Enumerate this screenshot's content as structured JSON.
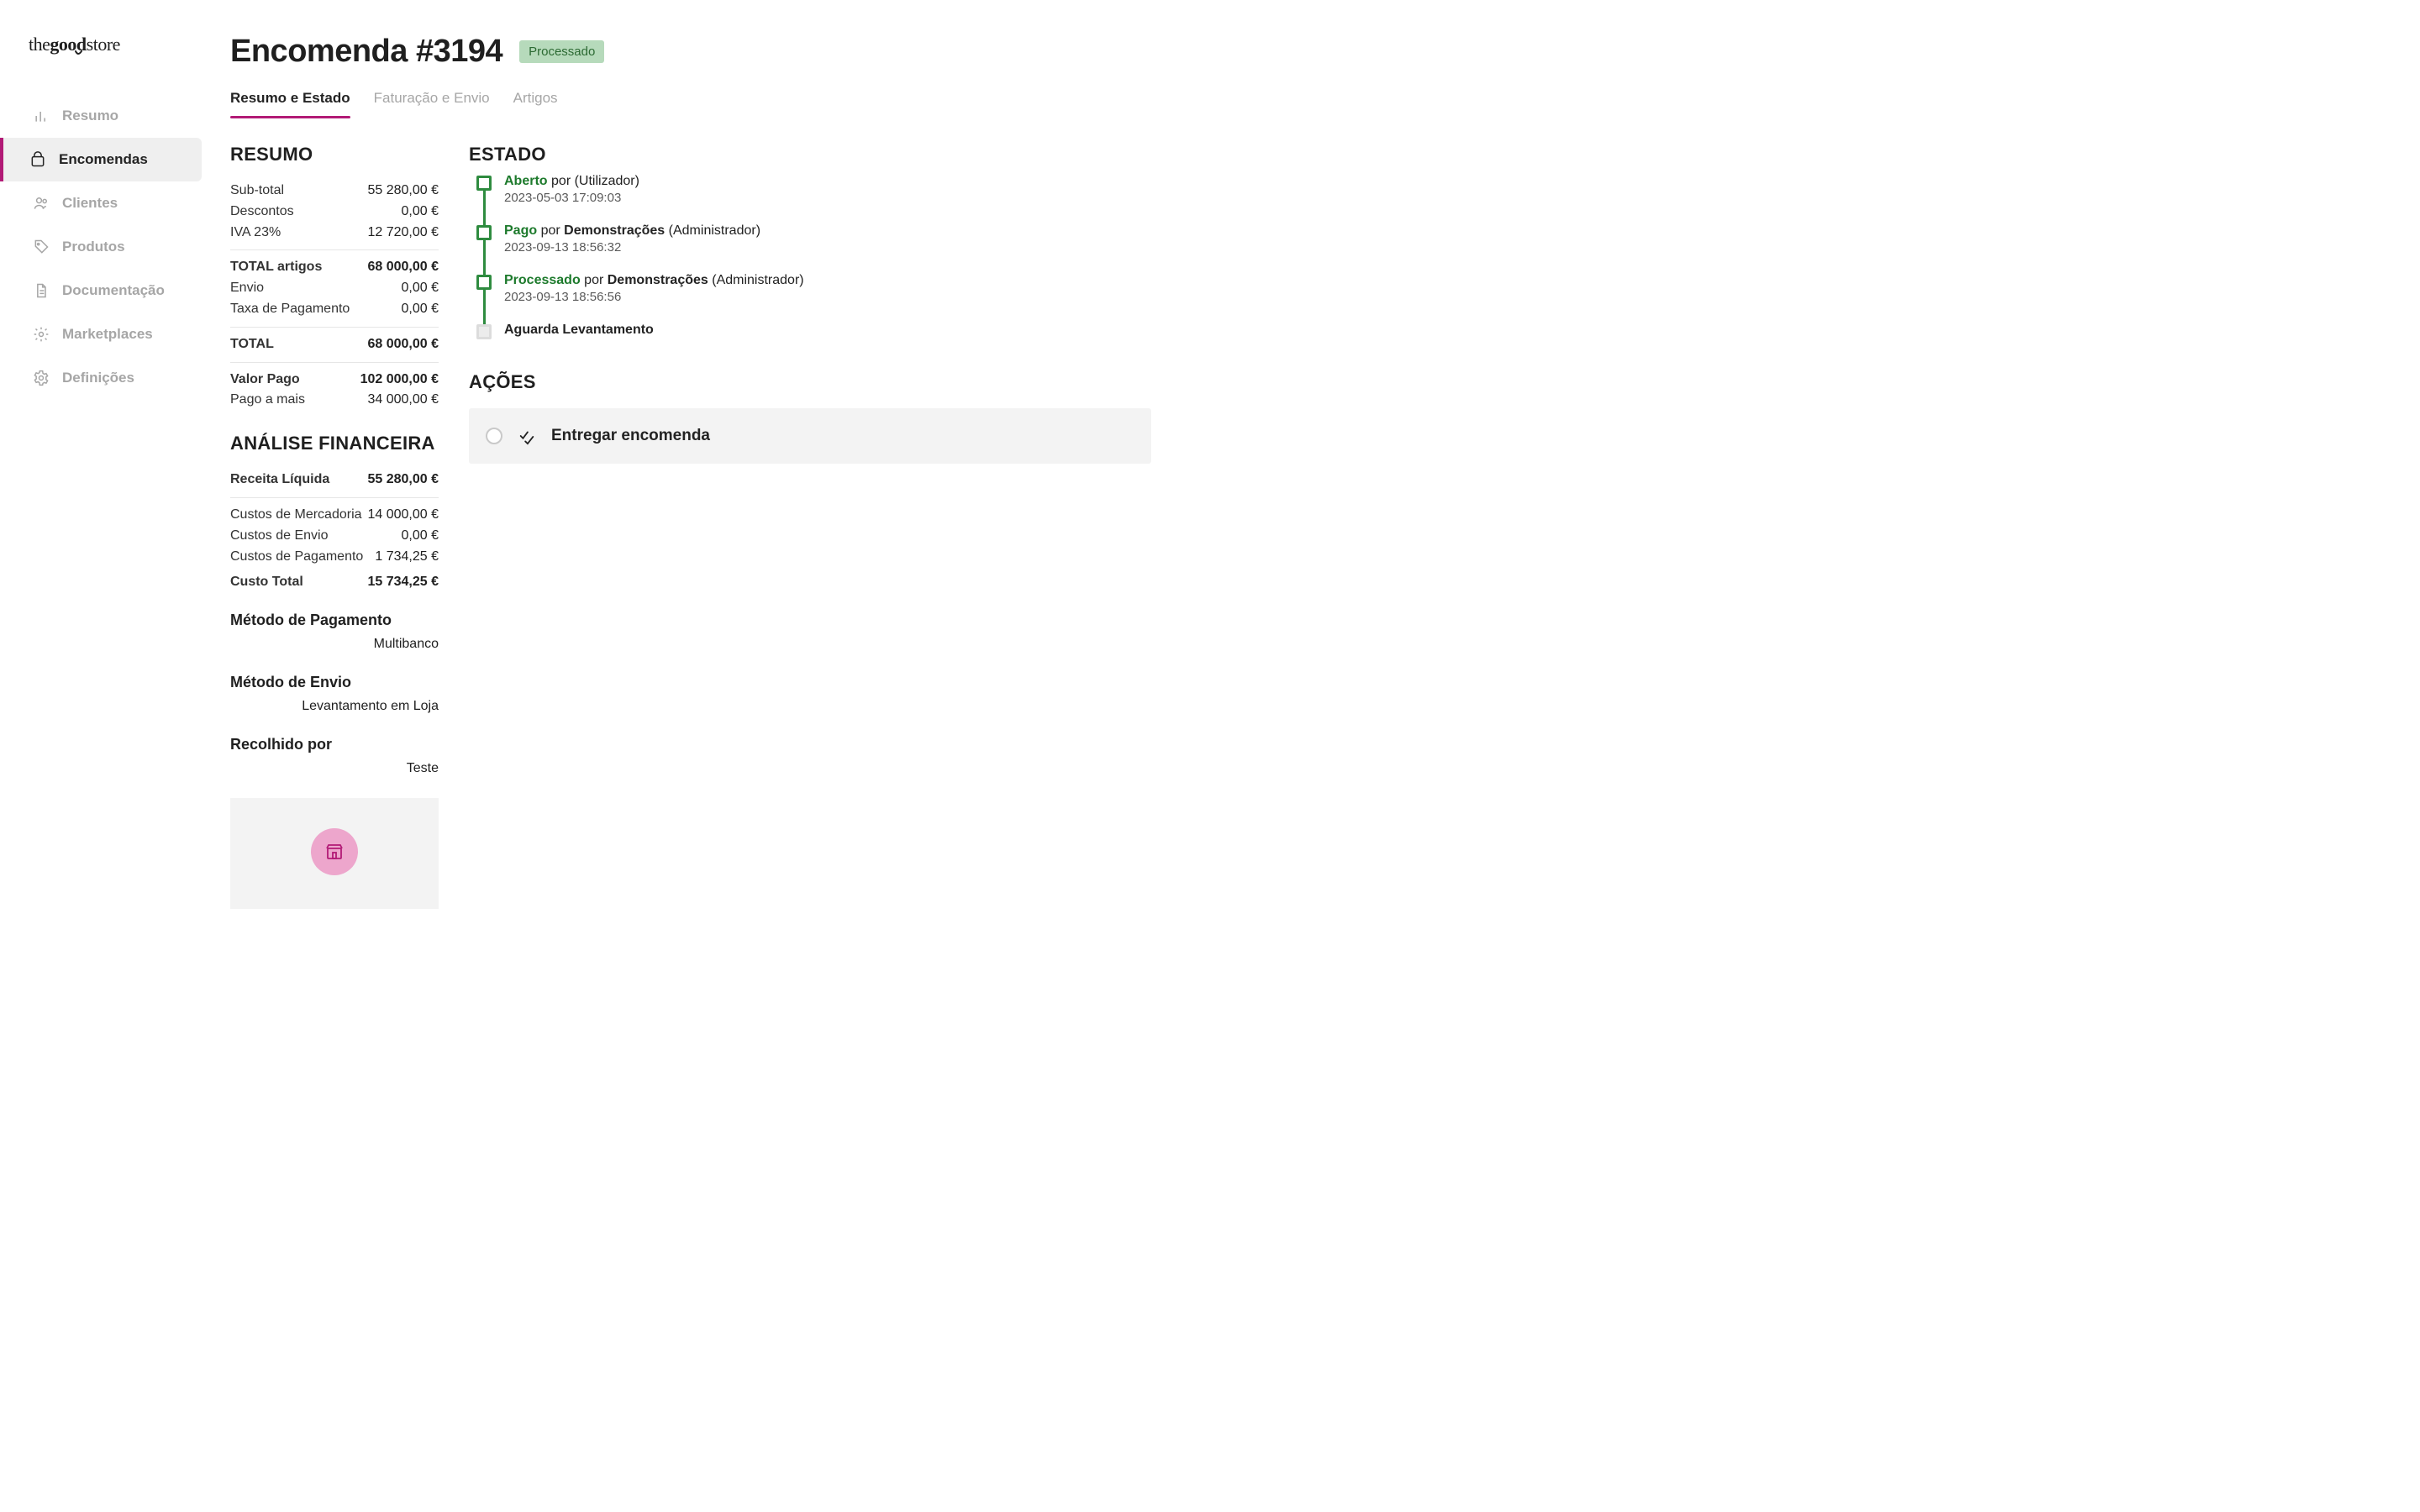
{
  "brand": {
    "name": "thegoodstore"
  },
  "sidebar": {
    "items": [
      {
        "label": "Resumo",
        "name": "sidebar-item-resumo",
        "icon": "bar-chart-icon",
        "active": false
      },
      {
        "label": "Encomendas",
        "name": "sidebar-item-encomendas",
        "icon": "package-icon",
        "active": true
      },
      {
        "label": "Clientes",
        "name": "sidebar-item-clientes",
        "icon": "users-icon",
        "active": false
      },
      {
        "label": "Produtos",
        "name": "sidebar-item-produtos",
        "icon": "tag-icon",
        "active": false
      },
      {
        "label": "Documentação",
        "name": "sidebar-item-documentacao",
        "icon": "file-icon",
        "active": false
      },
      {
        "label": "Marketplaces",
        "name": "sidebar-item-marketplaces",
        "icon": "gear-alt-icon",
        "active": false
      },
      {
        "label": "Definições",
        "name": "sidebar-item-definicoes",
        "icon": "gear-icon",
        "active": false
      }
    ]
  },
  "header": {
    "title": "Encomenda #3194",
    "status": "Processado"
  },
  "tabs": [
    {
      "label": "Resumo e Estado",
      "active": true
    },
    {
      "label": "Faturação e Envio",
      "active": false
    },
    {
      "label": "Artigos",
      "active": false
    }
  ],
  "resumo": {
    "title": "RESUMO",
    "lines1": [
      {
        "k": "Sub-total",
        "v": "55 280,00 €"
      },
      {
        "k": "Descontos",
        "v": "0,00 €"
      },
      {
        "k": "IVA 23%",
        "v": "12 720,00 €"
      }
    ],
    "total_articles": {
      "k": "TOTAL artigos",
      "v": "68 000,00 €"
    },
    "lines2": [
      {
        "k": "Envio",
        "v": "0,00 €"
      },
      {
        "k": "Taxa de Pagamento",
        "v": "0,00 €"
      }
    ],
    "total": {
      "k": "TOTAL",
      "v": "68 000,00 €"
    },
    "paid": {
      "k": "Valor Pago",
      "v": "102 000,00 €"
    },
    "over": {
      "k": "Pago a mais",
      "v": "34 000,00 €"
    }
  },
  "analise": {
    "title": "ANÁLISE FINANCEIRA",
    "receita": {
      "k": "Receita Líquida",
      "v": "55 280,00 €"
    },
    "custos": [
      {
        "k": "Custos de Mercadoria",
        "v": "14 000,00 €"
      },
      {
        "k": "Custos de Envio",
        "v": "0,00 €"
      },
      {
        "k": "Custos de Pagamento",
        "v": "1 734,25 €"
      }
    ],
    "custo_total": {
      "k": "Custo Total",
      "v": "15 734,25 €"
    },
    "pagamento_heading": "Método de Pagamento",
    "pagamento_value": "Multibanco",
    "envio_heading": "Método de Envio",
    "envio_value": "Levantamento em Loja",
    "recolhido_heading": "Recolhido por",
    "recolhido_value": "Teste"
  },
  "estado": {
    "title": "ESTADO",
    "items": [
      {
        "state": "Aberto",
        "by": "por",
        "who": null,
        "role": "(Utilizador)",
        "time": "2023-05-03 17:09:03",
        "done": true
      },
      {
        "state": "Pago",
        "by": "por",
        "who": "Demonstrações",
        "role": "(Administrador)",
        "time": "2023-09-13 18:56:32",
        "done": true
      },
      {
        "state": "Processado",
        "by": "por",
        "who": "Demonstrações",
        "role": "(Administrador)",
        "time": "2023-09-13 18:56:56",
        "done": true
      },
      {
        "state": "Aguarda Levantamento",
        "by": null,
        "who": null,
        "role": null,
        "time": null,
        "done": false
      }
    ]
  },
  "acoes": {
    "title": "AÇÕES",
    "deliver_label": "Entregar encomenda"
  }
}
